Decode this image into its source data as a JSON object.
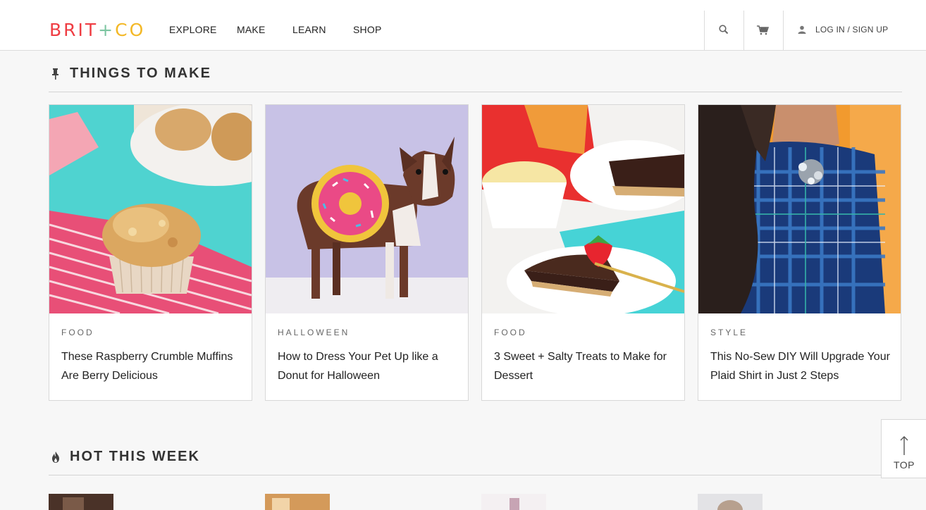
{
  "header": {
    "logo": {
      "part1": "BRIT",
      "plus": "+",
      "part2": "CO"
    },
    "nav": [
      "EXPLORE",
      "MAKE",
      "LEARN",
      "SHOP"
    ],
    "login": "LOG IN",
    "login_sep": "/",
    "signup": "SIGN UP"
  },
  "sections": {
    "things_to_make": "THINGS TO MAKE",
    "hot_this_week": "HOT THIS WEEK"
  },
  "cards": [
    {
      "category": "FOOD",
      "title": "These Raspberry Crumble Muffins Are Berry Delicious"
    },
    {
      "category": "HALLOWEEN",
      "title": "How to Dress Your Pet Up like a Donut for Halloween"
    },
    {
      "category": "FOOD",
      "title": "3 Sweet + Salty Treats to Make for Dessert"
    },
    {
      "category": "STYLE",
      "title": "This No-Sew DIY Will Upgrade Your Plaid Shirt in Just 2 Steps"
    }
  ],
  "to_top": "TOP",
  "icons": {
    "section1": "pin-icon",
    "section2": "flame-icon",
    "search": "search-icon",
    "cart": "cart-icon",
    "user": "user-icon",
    "to_top": "arrow-up-icon"
  },
  "colors": {
    "logo_red": "#ef3d43",
    "logo_green": "#7cc5a1",
    "logo_yellow": "#f3b826",
    "background": "#f7f7f7"
  }
}
